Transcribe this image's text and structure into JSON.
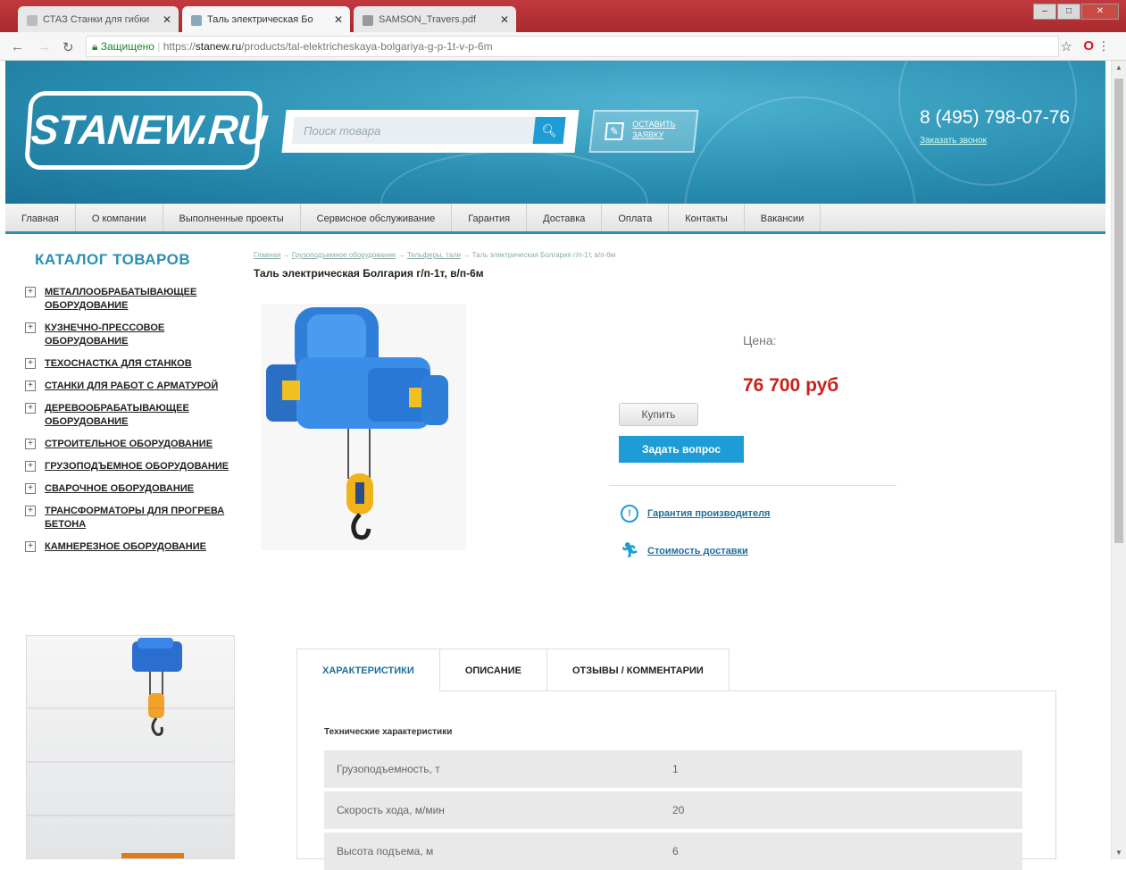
{
  "browser": {
    "tabs": [
      {
        "title": "СТАЗ Станки для гибки",
        "active": false
      },
      {
        "title": "Таль электрическая Бо",
        "active": true
      },
      {
        "title": "SAMSON_Travers.pdf",
        "active": false
      }
    ],
    "url_secure_label": "Защищено",
    "url_prefix": "https://",
    "url_host": "stanew.ru",
    "url_path": "/products/tal-elektricheskaya-bolgariya-g-p-1t-v-p-6m"
  },
  "header": {
    "logo": "STANEW.RU",
    "search_placeholder": "Поиск товара",
    "request_label_1": "ОСТАВИТЬ",
    "request_label_2": "ЗАЯВКУ",
    "phone": "8 (495) 798-07-76",
    "callback": "Заказать звонок"
  },
  "topnav": [
    "Главная",
    "О компании",
    "Выполненные проекты",
    "Сервисное обслуживание",
    "Гарантия",
    "Доставка",
    "Оплата",
    "Контакты",
    "Вакансии"
  ],
  "sidebar": {
    "title": "КАТАЛОГ ТОВАРОВ",
    "categories": [
      "МЕТАЛЛООБРАБАТЫВАЮЩЕЕ ОБОРУДОВАНИЕ",
      "КУЗНЕЧНО-ПРЕССОВОЕ ОБОРУДОВАНИЕ",
      "ТЕХОСНАСТКА ДЛЯ СТАНКОВ",
      "СТАНКИ ДЛЯ РАБОТ С АРМАТУРОЙ",
      "ДЕРЕВООБРАБАТЫВАЮЩЕЕ ОБОРУДОВАНИЕ",
      "СТРОИТЕЛЬНОЕ ОБОРУДОВАНИЕ",
      "ГРУЗОПОДЪЕМНОЕ ОБОРУДОВАНИЕ",
      "СВАРОЧНОЕ ОБОРУДОВАНИЕ",
      "ТРАНСФОРМАТОРЫ ДЛЯ ПРОГРЕВА БЕТОНА",
      "КАМНЕРЕЗНОЕ ОБОРУДОВАНИЕ"
    ]
  },
  "breadcrumb": {
    "items": [
      "Главная",
      "Грузоподъемное оборудование",
      "Тельферы, тали"
    ],
    "current": "Таль электрическая Болгария г/п-1т, в/п-6м",
    "separator": " → "
  },
  "product": {
    "title": "Таль электрическая Болгария г/п-1т, в/п-6м",
    "price_label": "Цена:",
    "price": "76 700 руб",
    "buy_label": "Купить",
    "ask_label": "Задать вопрос",
    "warranty_link": "Гарантия производителя",
    "delivery_link": "Стоимость доставки"
  },
  "tabs": [
    "ХАРАКТЕРИСТИКИ",
    "ОПИСАНИЕ",
    "ОТЗЫВЫ / КОММЕНТАРИИ"
  ],
  "specs": {
    "title": "Технические характеристики",
    "rows": [
      {
        "name": "Грузоподъемность, т",
        "value": "1"
      },
      {
        "name": "Скорость хода, м/мин",
        "value": "20"
      },
      {
        "name": "Высота подъема, м",
        "value": "6"
      }
    ]
  },
  "colors": {
    "accent": "#1e9cd6",
    "header_bg": "#2a8fb2",
    "price": "#c8211b"
  }
}
